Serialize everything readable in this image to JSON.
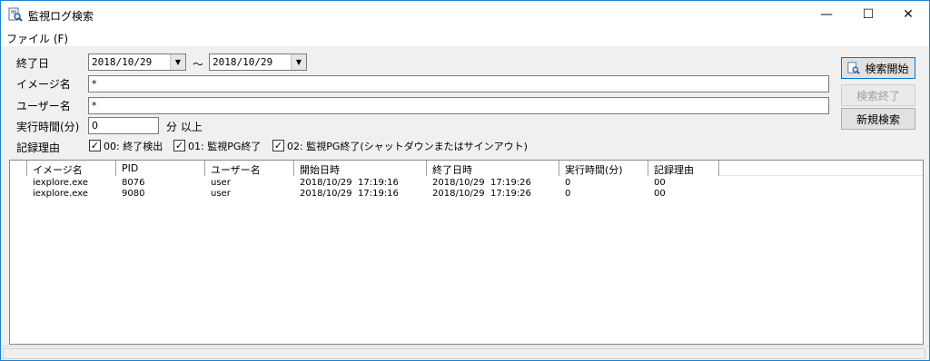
{
  "window": {
    "title": "監視ログ検索",
    "icon": "search-document-icon",
    "minimize_glyph": "—",
    "maximize_glyph": "☐",
    "close_glyph": "✕"
  },
  "menu": {
    "items": [
      {
        "label": "ファイル (F)"
      }
    ]
  },
  "form": {
    "end_date_label": "終了日",
    "end_date_from": "2018/10/29",
    "range_sep": "～",
    "end_date_to": "2018/10/29",
    "image_name_label": "イメージ名",
    "image_name_value": "*",
    "user_name_label": "ユーザー名",
    "user_name_value": "*",
    "exec_time_label": "実行時間(分)",
    "exec_time_value": "0",
    "exec_time_suffix": "分 以上",
    "reason_label": "記録理由",
    "reasons": [
      {
        "label": "00: 終了検出",
        "checked": true
      },
      {
        "label": "01: 監視PG終了",
        "checked": true
      },
      {
        "label": "02: 監視PG終了(シャットダウンまたはサインアウト)",
        "checked": true
      }
    ],
    "check_glyph": "✓",
    "dropdown_glyph": "▼"
  },
  "buttons": {
    "search_start": "検索開始",
    "search_end": "検索終了",
    "new_search": "新規検索"
  },
  "table": {
    "columns": [
      "イメージ名",
      "PID",
      "ユーザー名",
      "開始日時",
      "終了日時",
      "実行時間(分)",
      "記録理由"
    ],
    "rows": [
      [
        "iexplore.exe",
        "8076",
        "user",
        "2018/10/29  17:19:16",
        "2018/10/29  17:19:26",
        "0",
        "00"
      ],
      [
        "iexplore.exe",
        "9080",
        "user",
        "2018/10/29  17:19:16",
        "2018/10/29  17:19:26",
        "0",
        "00"
      ]
    ]
  }
}
